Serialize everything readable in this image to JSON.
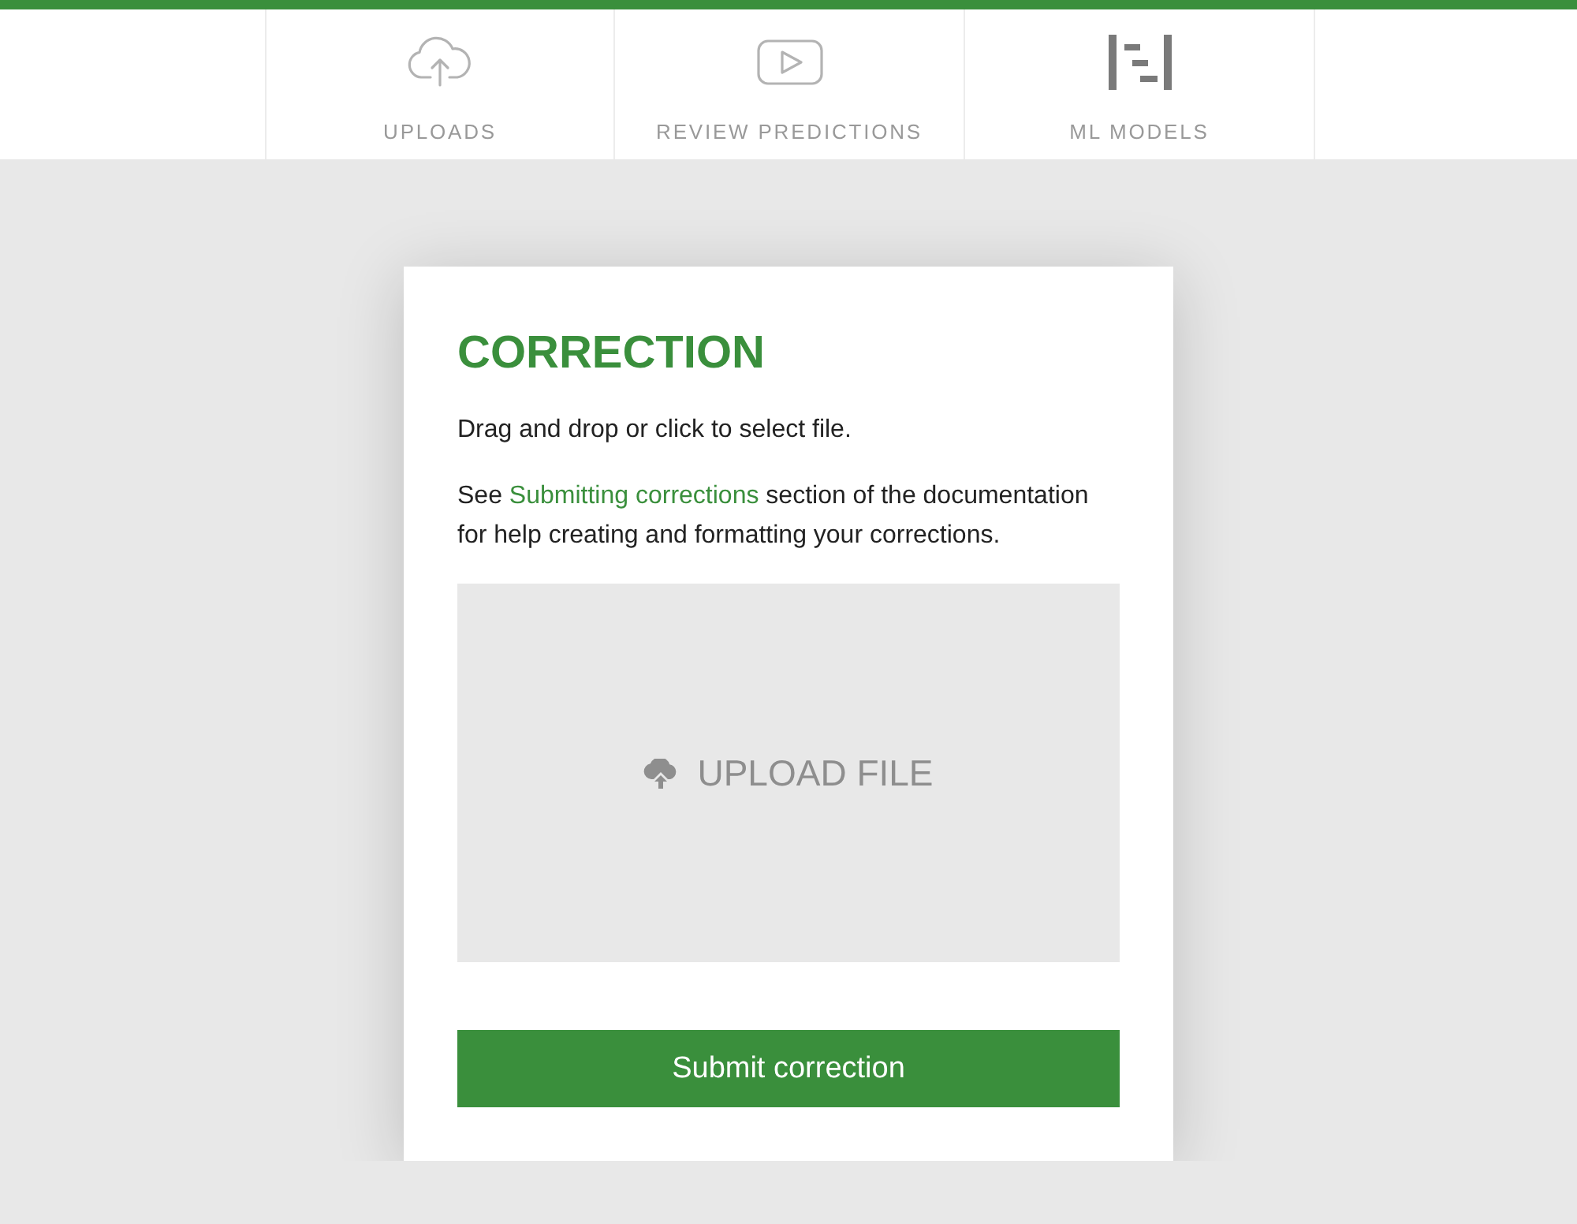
{
  "nav": {
    "tabs": [
      {
        "label": "UPLOADS",
        "kind": "cloud"
      },
      {
        "label": "REVIEW PREDICTIONS",
        "kind": "play"
      },
      {
        "label": "ML MODELS",
        "kind": "models"
      }
    ]
  },
  "card": {
    "title": "CORRECTION",
    "intro": "Drag and drop or click to select file.",
    "help": {
      "before": "See ",
      "link": "Submitting corrections",
      "after": " section of the documentation for help creating and formatting your corrections."
    },
    "dropzone": {
      "label": "UPLOAD FILE"
    },
    "submit": "Submit correction"
  }
}
